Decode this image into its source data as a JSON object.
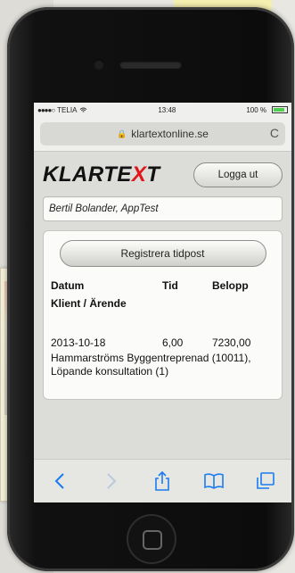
{
  "status": {
    "carrier": "TELIA",
    "time": "13:48",
    "battery": "100 %"
  },
  "browser": {
    "url": "klartextonline.se",
    "reload_label": "C"
  },
  "header": {
    "logo_pre": "KLARTE",
    "logo_x": "X",
    "logo_post": "T",
    "logout_label": "Logga ut"
  },
  "user": {
    "name": "Bertil Bolander, AppTest"
  },
  "card": {
    "register_label": "Registrera tidpost",
    "columns": [
      "Datum",
      "Tid",
      "Belopp"
    ],
    "subheader": "Klient / Ärende",
    "entries": [
      {
        "date": "2013-10-18",
        "time": "6,00",
        "amount": "7230,00",
        "description": "Hammarströms Byggentreprenad (10011), Löpande konsultation (1)"
      }
    ]
  },
  "toolbar": {
    "icons": [
      "back-icon",
      "forward-icon",
      "share-icon",
      "bookmarks-icon",
      "tabs-icon"
    ]
  },
  "colors": {
    "logo_accent": "#e0161b",
    "ios_blue": "#1a7cf0"
  }
}
